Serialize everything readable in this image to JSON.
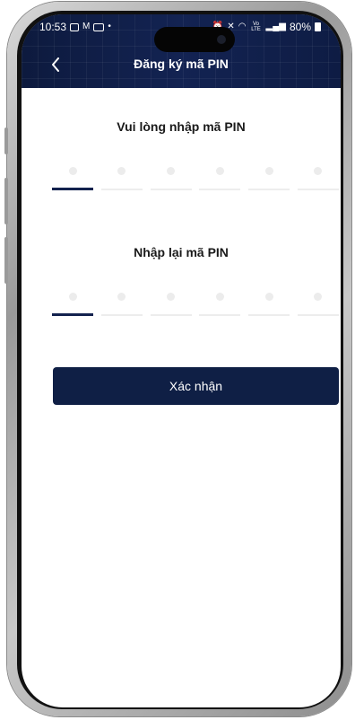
{
  "status_bar": {
    "time": "10:53",
    "dot": "•",
    "battery_text": "80%",
    "network_text": "Vo LTE",
    "icons_left": [
      "photo-icon",
      "gmail-icon",
      "youtube-icon"
    ],
    "icons_right": [
      "alarm-icon",
      "mute-icon",
      "wifi-icon",
      "signal-icon",
      "battery-icon"
    ]
  },
  "header": {
    "title": "Đăng ký mã PIN",
    "back_icon": "chevron-left-icon",
    "background_color": "#0f1d45"
  },
  "pin_entry": {
    "label": "Vui lòng nhập mã PIN",
    "length": 6,
    "filled": 0,
    "active_index": 0
  },
  "pin_confirm": {
    "label": "Nhập lại mã PIN",
    "length": 6,
    "filled": 0,
    "active_index": 0
  },
  "actions": {
    "submit_label": "Xác nhận",
    "button_color": "#0f1f45"
  }
}
